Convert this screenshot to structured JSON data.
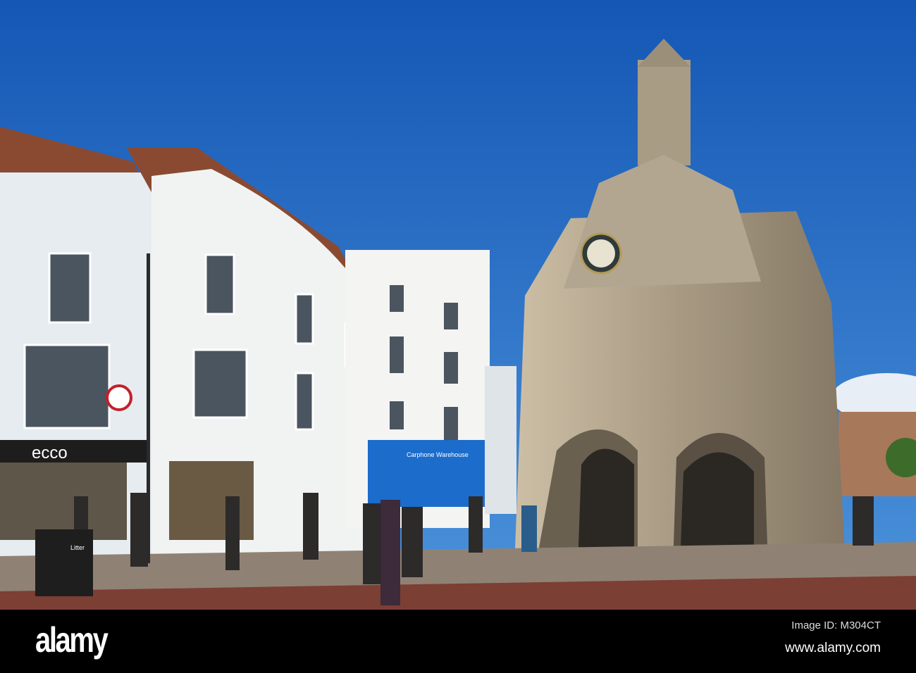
{
  "photo": {
    "signs": {
      "shoe_shop": "ecco",
      "phone_shop": "Carphone Warehouse",
      "bin": "Litter"
    },
    "colors": {
      "sky_top": "#1457b5",
      "sky_bottom": "#4c93db",
      "stone": "#b9ab93",
      "shop_blue": "#1c6ccc",
      "road": "#7c3f33"
    }
  },
  "footer": {
    "logo": "alamy",
    "image_id": "Image ID: M304CT",
    "url": "www.alamy.com"
  }
}
